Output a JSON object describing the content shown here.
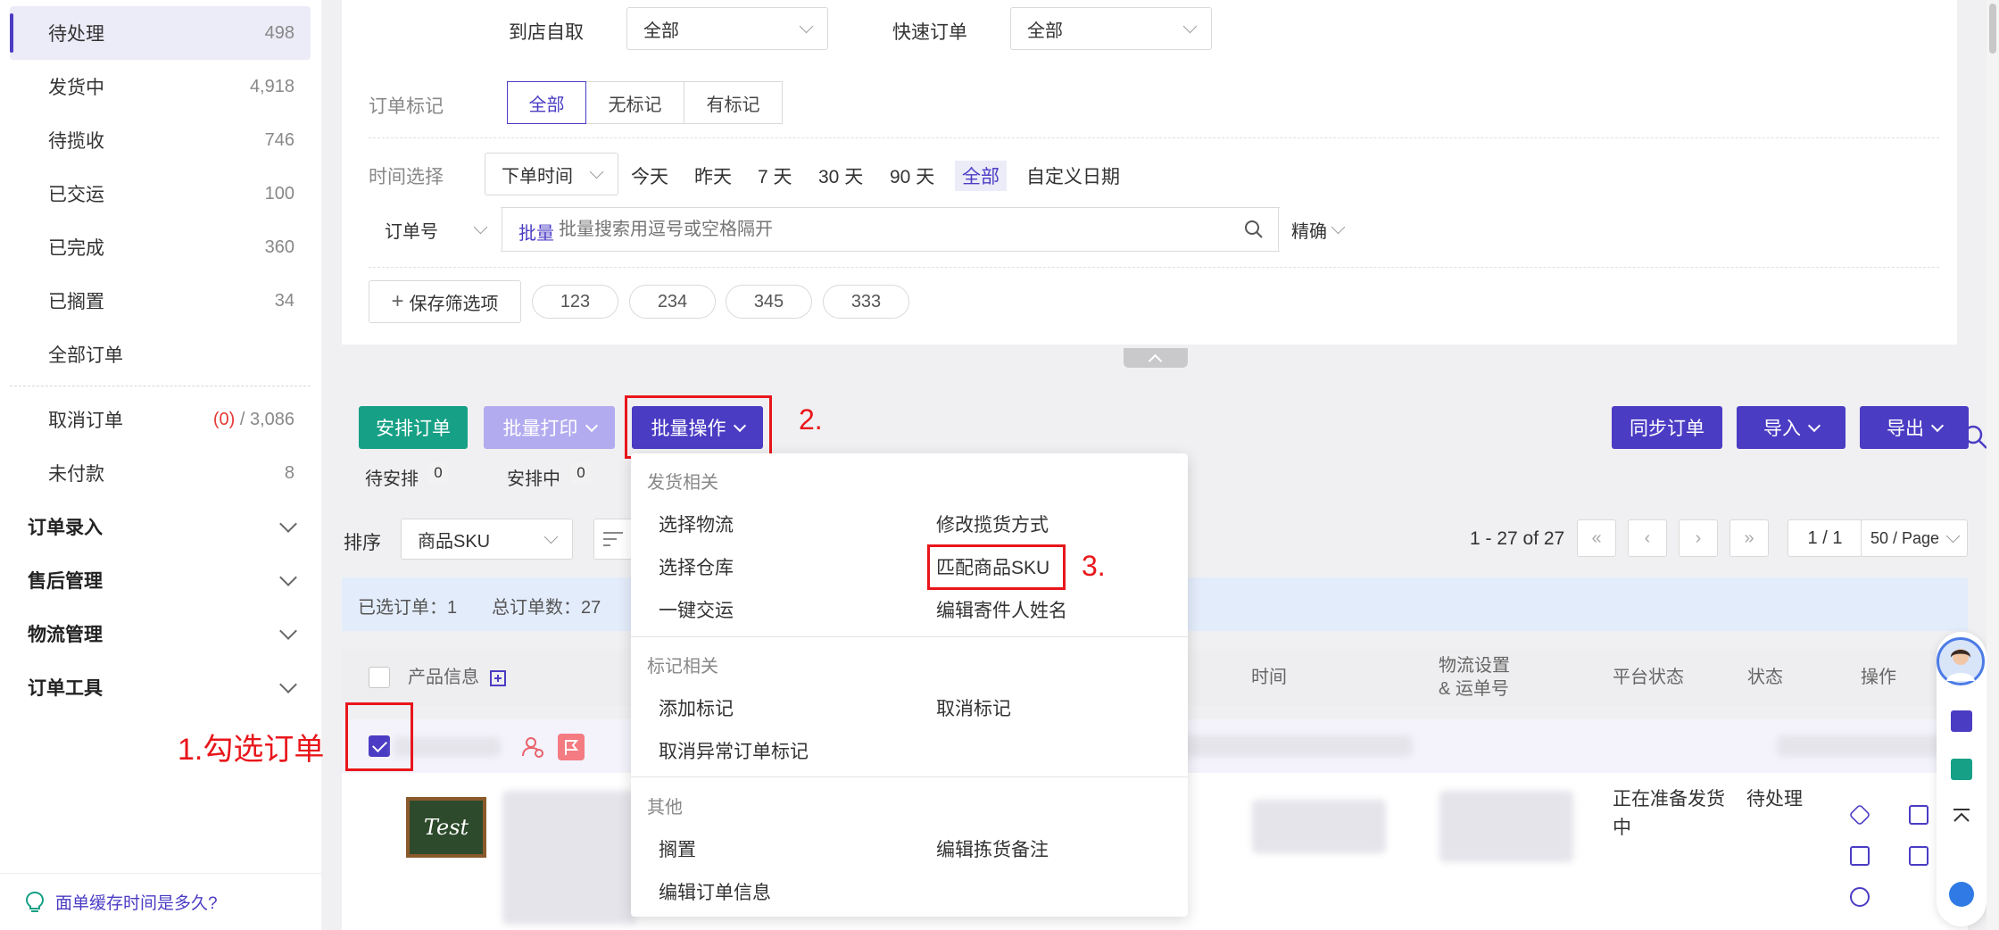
{
  "sidebar": {
    "items": [
      {
        "label": "待处理",
        "count": "498"
      },
      {
        "label": "发货中",
        "count": "4,918"
      },
      {
        "label": "待揽收",
        "count": "746"
      },
      {
        "label": "已交运",
        "count": "100"
      },
      {
        "label": "已完成",
        "count": "360"
      },
      {
        "label": "已搁置",
        "count": "34"
      },
      {
        "label": "全部订单",
        "count": ""
      }
    ],
    "cancel": {
      "label": "取消订单",
      "count_red": "(0)",
      "count_rest": " / 3,086"
    },
    "unpaid": {
      "label": "未付款",
      "count": "8"
    },
    "groups": [
      "订单录入",
      "售后管理",
      "物流管理",
      "订单工具"
    ],
    "help_text": "面单缓存时间是多久?"
  },
  "filters": {
    "pickup_label": "到店自取",
    "pickup_value": "全部",
    "express_label": "快速订单",
    "express_value": "全部",
    "mark_label": "订单标记",
    "mark_options": [
      "全部",
      "无标记",
      "有标记"
    ],
    "time_label": "时间选择",
    "time_type": "下单时间",
    "time_options": [
      "今天",
      "昨天",
      "7 天",
      "30 天",
      "90 天",
      "全部",
      "自定义日期"
    ],
    "search_field": "订单号",
    "batch_label": "批量",
    "search_placeholder": "批量搜索用逗号或空格隔开",
    "match_mode": "精确",
    "save_filter": "保存筛选项",
    "saved_tags": [
      "123",
      "234",
      "345",
      "333"
    ]
  },
  "actions": {
    "arrange": "安排订单",
    "batch_print": "批量打印",
    "batch_ops": "批量操作",
    "sync": "同步订单",
    "import": "导入",
    "export": "导出",
    "to_arrange": "待安排",
    "to_arrange_count": "0",
    "arranging": "安排中",
    "arranging_count": "0"
  },
  "sort": {
    "label": "排序",
    "value": "商品SKU"
  },
  "pagination": {
    "range": "1 - 27 of 27",
    "page": "1 / 1",
    "page_size": "50 / Page"
  },
  "selection": {
    "selected": "已选订单：1",
    "total": "总订单数：27"
  },
  "table": {
    "headers": {
      "product": "产品信息",
      "time": "时间",
      "logistics": "物流设置\n& 运单号",
      "platform_status": "平台状态",
      "status": "状态",
      "ops": "操作"
    },
    "row": {
      "platform_status": "正在准备发货中",
      "status": "待处理",
      "thumb_text": "Test"
    }
  },
  "menu": {
    "sections": [
      {
        "title": "发货相关",
        "items": [
          "选择物流",
          "修改揽货方式",
          "选择仓库",
          "匹配商品SKU",
          "一键交运",
          "编辑寄件人姓名"
        ]
      },
      {
        "title": "标记相关",
        "items": [
          "添加标记",
          "取消标记",
          "取消异常订单标记"
        ]
      },
      {
        "title": "其他",
        "items": [
          "搁置",
          "编辑拣货备注",
          "编辑订单信息"
        ]
      }
    ]
  },
  "annotations": {
    "step1": "1.勾选订单",
    "step2": "2.",
    "step3": "3."
  },
  "colors": {
    "accent": "#4b3cc4",
    "green": "#16a085",
    "annotation_red": "#e8161b"
  }
}
